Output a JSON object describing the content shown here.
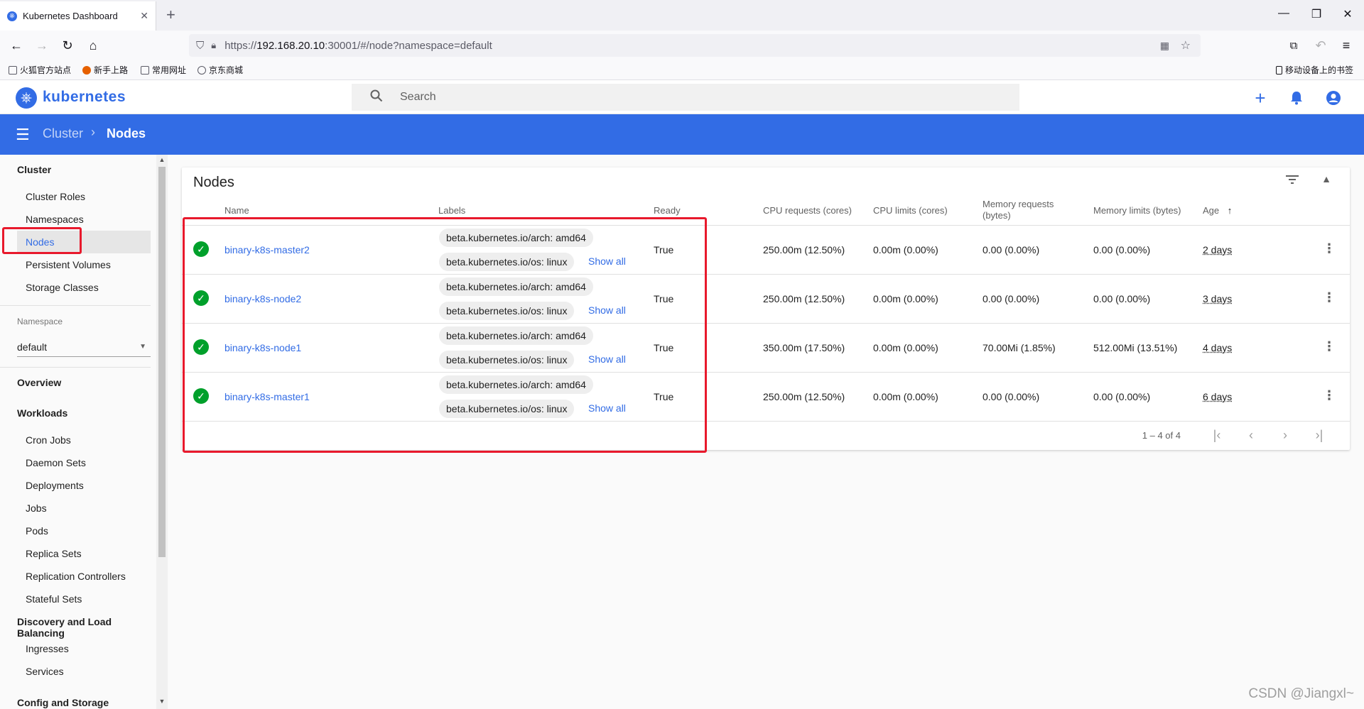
{
  "browser": {
    "tab_title": "Kubernetes Dashboard",
    "url_prefix": "https://",
    "url_host": "192.168.20.10",
    "url_rest": ":30001/#/node?namespace=default",
    "bookmarks": [
      "火狐官方站点",
      "新手上路",
      "常用网址",
      "京东商城"
    ],
    "mobile_bookmarks": "移动设备上的书签"
  },
  "header": {
    "brand": "kubernetes",
    "search_placeholder": "Search"
  },
  "breadcrumb": {
    "parent": "Cluster",
    "current": "Nodes"
  },
  "sidebar": {
    "cluster_heading": "Cluster",
    "cluster_items": [
      "Cluster Roles",
      "Namespaces",
      "Nodes",
      "Persistent Volumes",
      "Storage Classes"
    ],
    "namespace_label": "Namespace",
    "namespace_value": "default",
    "overview": "Overview",
    "workloads_heading": "Workloads",
    "workloads_items": [
      "Cron Jobs",
      "Daemon Sets",
      "Deployments",
      "Jobs",
      "Pods",
      "Replica Sets",
      "Replication Controllers",
      "Stateful Sets"
    ],
    "discovery_heading": "Discovery and Load Balancing",
    "discovery_items": [
      "Ingresses",
      "Services"
    ],
    "config_heading": "Config and Storage"
  },
  "nodes_card": {
    "title": "Nodes",
    "columns": {
      "name": "Name",
      "labels": "Labels",
      "ready": "Ready",
      "cpu_requests": "CPU requests (cores)",
      "cpu_limits": "CPU limits (cores)",
      "memory_requests_1": "Memory requests",
      "memory_requests_2": "(bytes)",
      "memory_limits": "Memory limits (bytes)",
      "age": "Age"
    },
    "show_all": "Show all",
    "rows": [
      {
        "name": "binary-k8s-master2",
        "label_arch": "beta.kubernetes.io/arch: amd64",
        "label_os": "beta.kubernetes.io/os: linux",
        "ready": "True",
        "cpu_requests": "250.00m (12.50%)",
        "cpu_limits": "0.00m (0.00%)",
        "memory_requests": "0.00 (0.00%)",
        "memory_limits": "0.00 (0.00%)",
        "age": "2 days"
      },
      {
        "name": "binary-k8s-node2",
        "label_arch": "beta.kubernetes.io/arch: amd64",
        "label_os": "beta.kubernetes.io/os: linux",
        "ready": "True",
        "cpu_requests": "250.00m (12.50%)",
        "cpu_limits": "0.00m (0.00%)",
        "memory_requests": "0.00 (0.00%)",
        "memory_limits": "0.00 (0.00%)",
        "age": "3 days"
      },
      {
        "name": "binary-k8s-node1",
        "label_arch": "beta.kubernetes.io/arch: amd64",
        "label_os": "beta.kubernetes.io/os: linux",
        "ready": "True",
        "cpu_requests": "350.00m (17.50%)",
        "cpu_limits": "0.00m (0.00%)",
        "memory_requests": "70.00Mi (1.85%)",
        "memory_limits": "512.00Mi (13.51%)",
        "age": "4 days"
      },
      {
        "name": "binary-k8s-master1",
        "label_arch": "beta.kubernetes.io/arch: amd64",
        "label_os": "beta.kubernetes.io/os: linux",
        "ready": "True",
        "cpu_requests": "250.00m (12.50%)",
        "cpu_limits": "0.00m (0.00%)",
        "memory_requests": "0.00 (0.00%)",
        "memory_limits": "0.00 (0.00%)",
        "age": "6 days"
      }
    ],
    "pager_range": "1 – 4 of 4"
  },
  "watermark": "CSDN @Jiangxl~",
  "colors": {
    "accent": "#326ce5",
    "ready_green": "#00a02b",
    "highlight_red": "#e8192c"
  }
}
